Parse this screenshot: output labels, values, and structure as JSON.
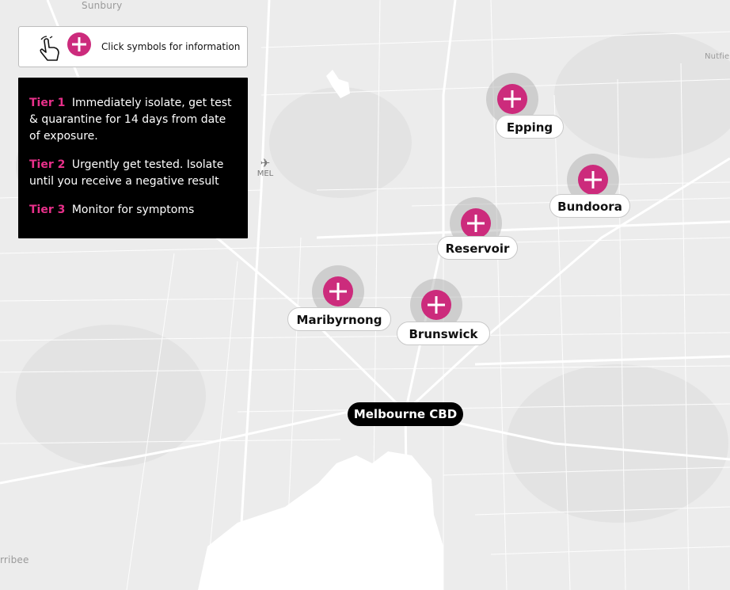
{
  "map": {
    "place_labels": {
      "sunbury": "Sunbury",
      "nutfield": "Nutfield",
      "werribee": "rribee"
    },
    "airport": {
      "icon": "plane-icon",
      "code": "MEL"
    }
  },
  "hint": {
    "hand_icon": "tap-hand-icon",
    "plus_icon": "plus-icon",
    "text": "Click symbols for information"
  },
  "tiers": [
    {
      "label": "Tier 1",
      "text": "Immediately isolate, get test & quarantine for 14 days from date of exposure."
    },
    {
      "label": "Tier 2",
      "text": "Urgently get tested. Isolate until you receive a negative result"
    },
    {
      "label": "Tier 3",
      "text": "Monitor for symptoms"
    }
  ],
  "markers": {
    "epping": "Epping",
    "bundoora": "Bundoora",
    "reservoir": "Reservoir",
    "maribyrnong": "Maribyrnong",
    "brunswick": "Brunswick"
  },
  "cbd_label": "Melbourne CBD",
  "colors": {
    "accent_magenta": "#cc2b7c",
    "tier_label": "#e8308a",
    "map_land": "#ececec",
    "map_water": "#ffffff",
    "panel_bg": "#000000"
  }
}
